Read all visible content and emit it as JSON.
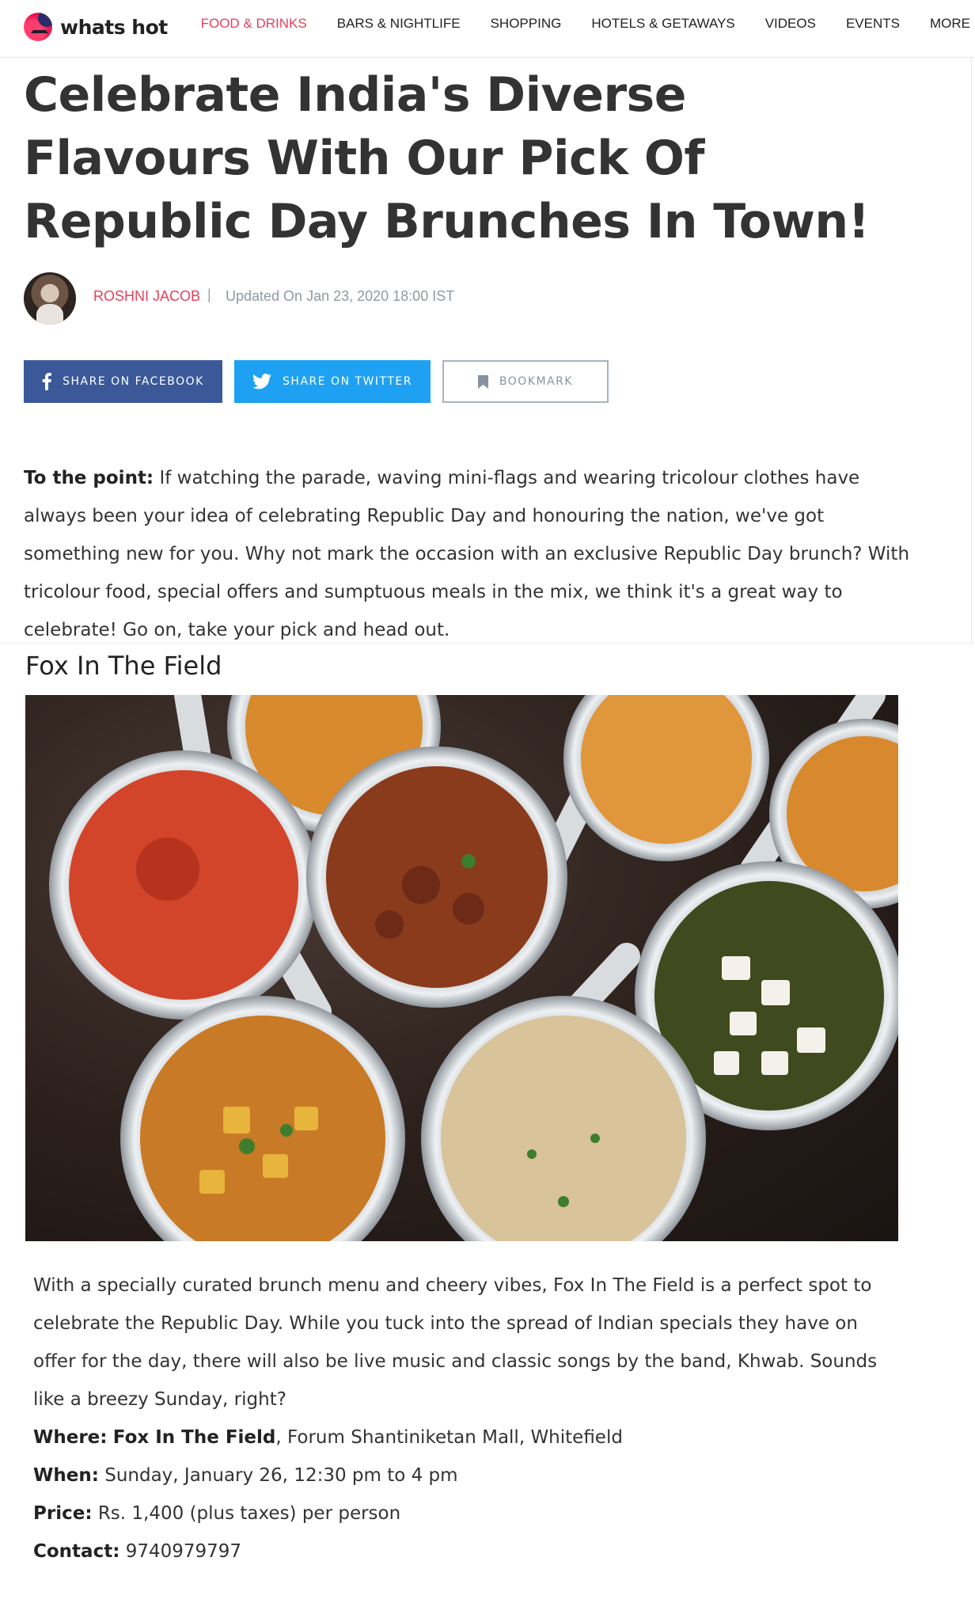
{
  "site": {
    "logo_text": "whats hot"
  },
  "nav": {
    "items": [
      {
        "label": "FOOD & DRINKS",
        "active": true
      },
      {
        "label": "BARS & NIGHTLIFE"
      },
      {
        "label": "SHOPPING"
      },
      {
        "label": "HOTELS & GETAWAYS"
      },
      {
        "label": "VIDEOS"
      },
      {
        "label": "EVENTS"
      },
      {
        "label": "MORE"
      }
    ]
  },
  "article": {
    "title": "Celebrate India's Diverse Flavours With Our Pick Of Republic Day Brunches In Town!",
    "author": "ROSHNI JACOB",
    "separator": "|",
    "updated": "Updated On Jan 23, 2020 18:00 IST",
    "share": {
      "facebook": "SHARE ON FACEBOOK",
      "twitter": "SHARE ON TWITTER",
      "bookmark": "BOOKMARK"
    },
    "intro_label": "To the point:",
    "intro_text": " If watching the parade, waving mini-flags and wearing tricolour clothes have always been your idea of celebrating Republic Day and honouring the nation, we've got something new for you. Why not mark the occasion with an exclusive Republic Day brunch? With tricolour food, special offers and sumptuous meals in the mix, we think it's a great way to celebrate! Go on, take your pick and head out."
  },
  "section": {
    "title": "Fox In The Field",
    "description": "With a specially curated brunch menu and cheery vibes, Fox In The Field is a perfect spot to celebrate the Republic Day. While you tuck into the spread of Indian specials they have on offer for the day, there will also be live music and classic songs by the band, Khwab. Sounds like a breezy Sunday, right?",
    "where_label": "Where:",
    "where_venue": "Fox In The Field",
    "where_rest": ", Forum Shantiniketan Mall, Whitefield",
    "when_label": "When:",
    "when_value": " Sunday, January 26, 12:30 pm to 4 pm",
    "price_label": "Price:",
    "price_value": " Rs. 1,400 (plus taxes) per person",
    "contact_label": "Contact:",
    "contact_value": " 9740979797"
  },
  "colors": {
    "accent": "#e8405a",
    "facebook": "#3b5998",
    "twitter": "#1ea1f2",
    "bookmark_border": "#a8b2bf"
  },
  "icons": {
    "facebook": "facebook-icon",
    "twitter": "twitter-icon",
    "bookmark": "bookmark-icon"
  }
}
